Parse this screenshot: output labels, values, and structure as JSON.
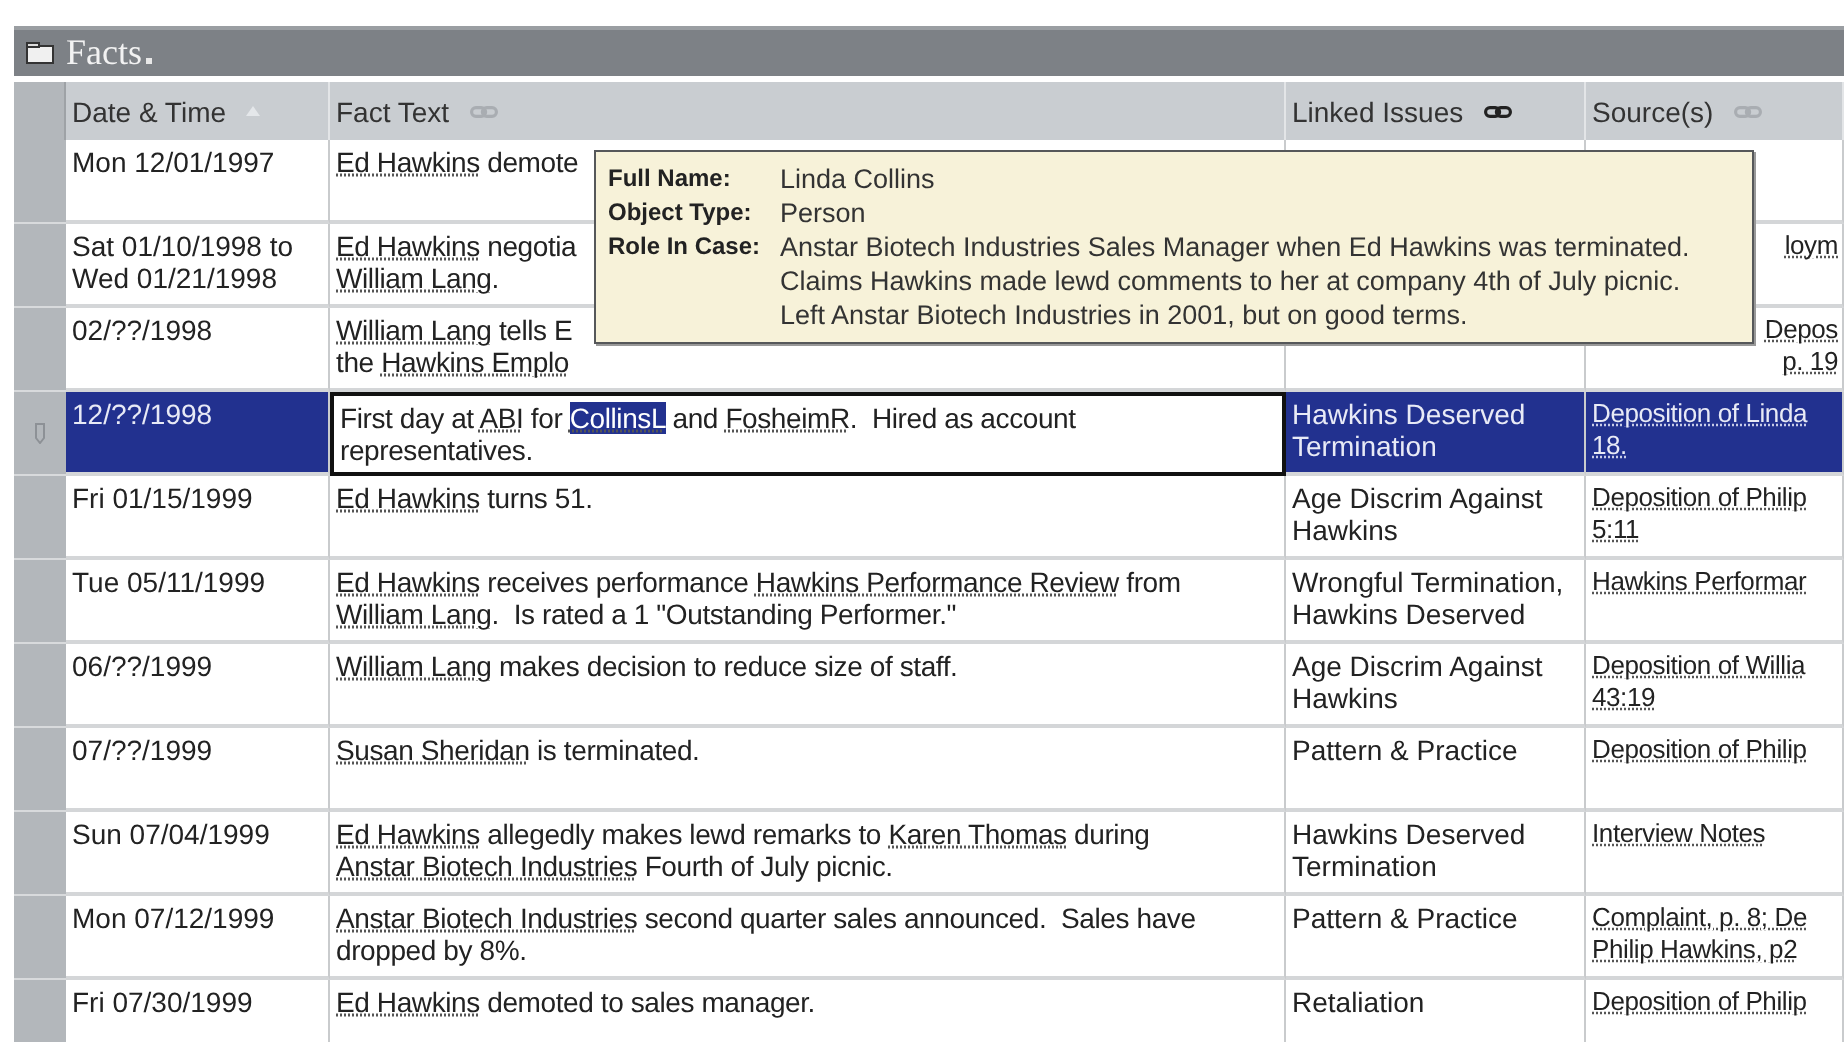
{
  "panel": {
    "title": "Facts"
  },
  "columns": [
    {
      "label": "Date & Time",
      "kind": "sort",
      "active": false
    },
    {
      "label": "Fact Text",
      "kind": "link",
      "active": false
    },
    {
      "label": "Linked Issues",
      "kind": "link",
      "active": true
    },
    {
      "label": "Source(s)",
      "kind": "link",
      "active": false
    }
  ],
  "rows": [
    {
      "selected": false,
      "date": "Mon 12/01/1997",
      "fact": [
        {
          "kind": "link",
          "text": "Ed Hawkins"
        },
        {
          "kind": "text",
          "text": " demote"
        }
      ],
      "issues": "",
      "source": "",
      "partial": false
    },
    {
      "selected": false,
      "date": "Sat 01/10/1998 to\nWed 01/21/1998",
      "fact": [
        {
          "kind": "link",
          "text": "Ed Hawkins"
        },
        {
          "kind": "text",
          "text": " negotia\n"
        },
        {
          "kind": "link",
          "text": "William Lang"
        },
        {
          "kind": "text",
          "text": "."
        }
      ],
      "issues": "",
      "source": "loym",
      "partial": true
    },
    {
      "selected": false,
      "date": "02/??/1998",
      "fact": [
        {
          "kind": "link",
          "text": "William Lang"
        },
        {
          "kind": "text",
          "text": " tells E\nthe "
        },
        {
          "kind": "link",
          "text": "Hawkins Emplo"
        }
      ],
      "issues": "",
      "source": "Depos\np. 19",
      "partial": true
    },
    {
      "selected": true,
      "date": "12/??/1998",
      "fact": [
        {
          "kind": "text",
          "text": "First day at "
        },
        {
          "kind": "link",
          "text": "ABI"
        },
        {
          "kind": "text",
          "text": " for "
        },
        {
          "kind": "selected-link",
          "text": "CollinsL"
        },
        {
          "kind": "text",
          "text": " and "
        },
        {
          "kind": "link",
          "text": "FosheimR"
        },
        {
          "kind": "text",
          "text": ".  Hired as account\nrepresentatives."
        }
      ],
      "issues": "Hawkins Deserved\nTermination",
      "source": "Deposition of Linda\n18.",
      "partial": false
    },
    {
      "selected": false,
      "date": "Fri 01/15/1999",
      "fact": [
        {
          "kind": "link",
          "text": "Ed Hawkins"
        },
        {
          "kind": "text",
          "text": " turns 51."
        }
      ],
      "issues": "Age Discrim Against\nHawkins",
      "source": "Deposition of Philip\n5:11",
      "partial": false
    },
    {
      "selected": false,
      "date": "Tue 05/11/1999",
      "fact": [
        {
          "kind": "link",
          "text": "Ed Hawkins"
        },
        {
          "kind": "text",
          "text": " receives performance "
        },
        {
          "kind": "link",
          "text": "Hawkins Performance Review"
        },
        {
          "kind": "text",
          "text": " from\n"
        },
        {
          "kind": "link",
          "text": "William Lang"
        },
        {
          "kind": "text",
          "text": ".  Is rated a 1 \"Outstanding Performer.\""
        }
      ],
      "issues": "Wrongful Termination,\nHawkins Deserved",
      "source": "Hawkins Performar",
      "partial": false
    },
    {
      "selected": false,
      "date": "06/??/1999",
      "fact": [
        {
          "kind": "link",
          "text": "William Lang"
        },
        {
          "kind": "text",
          "text": " makes decision to reduce size of staff."
        }
      ],
      "issues": "Age Discrim Against\nHawkins",
      "source": "Deposition of Willia\n43:19",
      "partial": false
    },
    {
      "selected": false,
      "date": "07/??/1999",
      "fact": [
        {
          "kind": "link",
          "text": "Susan Sheridan"
        },
        {
          "kind": "text",
          "text": " is terminated."
        }
      ],
      "issues": "Pattern & Practice",
      "source": "Deposition of Philip",
      "partial": false
    },
    {
      "selected": false,
      "date": "Sun 07/04/1999",
      "fact": [
        {
          "kind": "link",
          "text": "Ed Hawkins"
        },
        {
          "kind": "text",
          "text": " allegedly makes lewd remarks to "
        },
        {
          "kind": "link",
          "text": "Karen Thomas"
        },
        {
          "kind": "text",
          "text": " during\n"
        },
        {
          "kind": "link",
          "text": "Anstar Biotech Industries"
        },
        {
          "kind": "text",
          "text": " Fourth of July picnic."
        }
      ],
      "issues": "Hawkins Deserved\nTermination",
      "source": "Interview Notes",
      "partial": false
    },
    {
      "selected": false,
      "date": "Mon 07/12/1999",
      "fact": [
        {
          "kind": "link",
          "text": "Anstar Biotech Industries"
        },
        {
          "kind": "text",
          "text": " second quarter sales announced.  Sales have\ndropped by 8%."
        }
      ],
      "issues": "Pattern & Practice",
      "source": "Complaint, p. 8; De\nPhilip Hawkins, p2",
      "partial": false
    },
    {
      "selected": false,
      "date": "Fri 07/30/1999",
      "fact": [
        {
          "kind": "link",
          "text": "Ed Hawkins"
        },
        {
          "kind": "text",
          "text": " demoted to sales manager."
        }
      ],
      "issues": "Retaliation",
      "source": "Deposition of Philip",
      "partial": false
    }
  ],
  "tooltip": [
    {
      "label": "Full Name:",
      "value": "Linda Collins"
    },
    {
      "label": "Object Type:",
      "value": "Person"
    },
    {
      "label": "Role In Case:",
      "value": "Anstar Biotech Industries Sales Manager when Ed Hawkins was terminated.  Claims Hawkins made lewd comments to her at company 4th of July picnic.  Left Anstar Biotech Industries in 2001, but on good terms."
    }
  ]
}
